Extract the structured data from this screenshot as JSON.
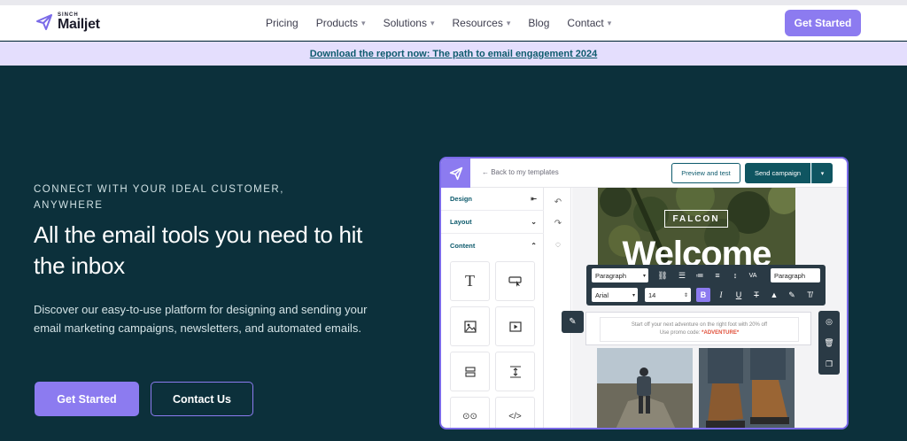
{
  "header": {
    "logo": {
      "sinch": "SINCH",
      "mailjet": "Mailjet"
    },
    "nav": [
      {
        "label": "Pricing",
        "dropdown": false
      },
      {
        "label": "Products",
        "dropdown": true
      },
      {
        "label": "Solutions",
        "dropdown": true
      },
      {
        "label": "Resources",
        "dropdown": true
      },
      {
        "label": "Blog",
        "dropdown": false
      },
      {
        "label": "Contact",
        "dropdown": true
      }
    ],
    "cta": "Get Started"
  },
  "announcement": {
    "text": "Download the report now: The path to email engagement 2024"
  },
  "hero": {
    "eyebrow": "CONNECT WITH YOUR IDEAL CUSTOMER, ANYWHERE",
    "title": "All the email tools you need to hit the inbox",
    "description": "Discover our easy-to-use platform for designing and sending your email marketing campaigns, newsletters, and automated emails.",
    "primary_button": "Get Started",
    "secondary_button": "Contact Us"
  },
  "editor": {
    "back_link": "← Back to my templates",
    "preview_button": "Preview and test",
    "send_button": "Send campaign",
    "sidebar": {
      "design": "Design",
      "layout": "Layout",
      "content": "Content"
    },
    "email": {
      "brand": "FALCON",
      "headline": "Welcome",
      "body_line1": "Start off your next adventure on the right foot with 20% off",
      "body_line2_prefix": "Use promo code: ",
      "promo_code": "*ADVENTURE*"
    },
    "toolbar": {
      "block_style": "Paragraph",
      "font": "Arial",
      "font_size": "14",
      "style_right": "Paragraph"
    }
  },
  "colors": {
    "brand_purple": "#8c7bf0",
    "hero_bg": "#0c303b",
    "banner_bg": "#e4defd",
    "banner_text": "#0d5a6c",
    "send_button": "#0f5561",
    "promo_red": "#e0503a"
  },
  "icons": [
    "paper-plane-icon",
    "chevron-down-icon",
    "text-icon",
    "button-icon",
    "image-icon",
    "video-icon",
    "divider-icon",
    "spacer-icon",
    "social-icon",
    "code-icon",
    "undo-icon",
    "redo-icon",
    "comment-icon",
    "pencil-icon",
    "trash-icon",
    "copy-icon"
  ]
}
